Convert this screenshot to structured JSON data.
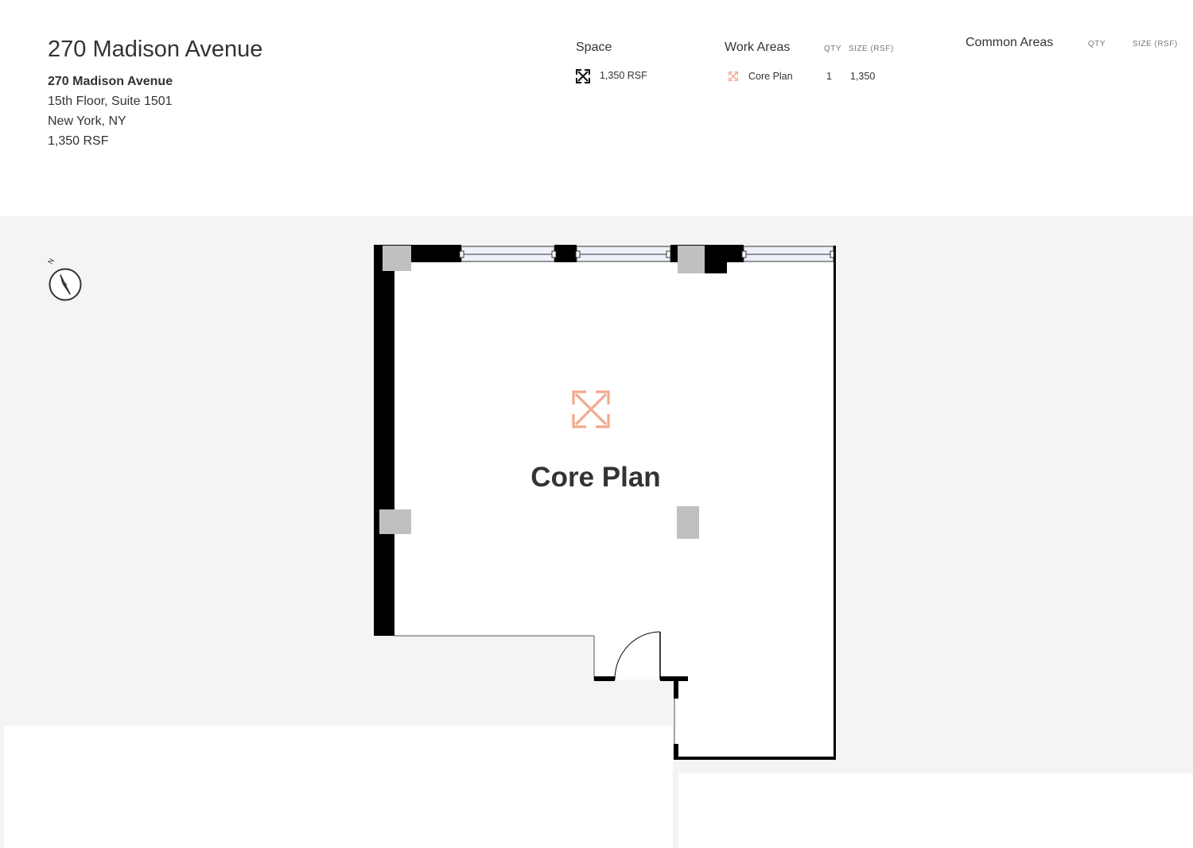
{
  "header": {
    "title": "270 Madison Avenue",
    "address_name": "270 Madison Avenue",
    "address_lines": [
      "15th Floor, Suite 1501",
      "New York, NY",
      "1,350 RSF"
    ]
  },
  "space": {
    "heading": "Space",
    "value": "1,350 RSF",
    "icon": "expand-arrows-icon"
  },
  "work_areas": {
    "heading": "Work Areas",
    "qty_label": "QTY",
    "size_label": "SIZE (RSF)",
    "rows": [
      {
        "name": "Core Plan",
        "qty": "1",
        "size": "1,350",
        "icon": "expand-arrows-icon",
        "color": "#f2a98c"
      }
    ]
  },
  "common_areas": {
    "heading": "Common Areas",
    "qty_label": "QTY",
    "size_label": "SIZE (RSF)"
  },
  "plan": {
    "room_label": "Core Plan",
    "compass_label": "N",
    "colors": {
      "background": "#f4f4f4",
      "room": "#ffffff",
      "wall": "#000000",
      "column": "#c0c0c0",
      "accent": "#f2a98c",
      "compass_needle": "#f5b800"
    }
  }
}
